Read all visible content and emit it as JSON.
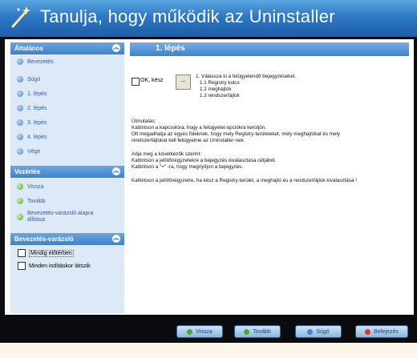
{
  "window": {
    "title": "Tanulja, hogy működik az Uninstaller"
  },
  "sidebar": {
    "general": {
      "heading": "Általános",
      "items": [
        {
          "label": "Bevezetés"
        },
        {
          "label": "Súgó"
        },
        {
          "label": "1. lépés"
        },
        {
          "label": "2. lépés"
        },
        {
          "label": "3. lépés"
        },
        {
          "label": "4. lépés"
        },
        {
          "label": "Vége"
        }
      ]
    },
    "control": {
      "heading": "Vezérlés",
      "items": [
        {
          "label": "Vissza"
        },
        {
          "label": "Tovább"
        },
        {
          "label": "Bevezetés-varázsló alapra"
        },
        {
          "label": "állítása"
        }
      ]
    },
    "wizard": {
      "heading": "Bevezetés-varázsló",
      "options": [
        {
          "label": "Mindig előtérben"
        },
        {
          "label": "Minden indításkor látszik"
        }
      ]
    }
  },
  "main": {
    "step_title": "1. lépés",
    "ok_label": "OK, kész",
    "dots_button": "...",
    "task_lines": [
      "1. Válassza ki a felügyelendő bejegyzéseket.",
      "1.1 Registry kulcs",
      "1.2 meghajtók",
      "1.3 rendszerfájlok"
    ],
    "instructions": [
      "Útmutatás:",
      "Kattintson a kapcsolóra, hogy a felügyelet-opciókra kerüljön.",
      "Ott megadhatja az egyes füleknek, hogy mely Registry-területeket, mely meghajtókat és mely",
      "rendszerfájlokat kell felügyelnie az Uninstaller-nek.",
      "",
      "Adja meg a következők szerint:",
      "Kattintson a jelölőnégyzetekre a bejegyzés kiválasztása céljából.",
      "Kattintson a \"+\" -ra, hogy megnyíljon a bejegyzés.",
      "",
      "Kattintson a jelölőnégyzetre, ha kész a Registry-terület, a meghajtó és a rendszerfájlok kiválasztása !"
    ]
  },
  "buttons": {
    "back": "Vissza",
    "next": "Tovább",
    "help": "Súgó",
    "finish": "Befejezés"
  },
  "colors": {
    "title_bar": "#2e78c4",
    "panel_header": "#3e82cc",
    "sidebar_bg": "#dde9f7",
    "link_text": "#2d5ea8",
    "green_dot": "#4fa72f",
    "blue_dot": "#4b86c9",
    "red_dot": "#d9362b"
  }
}
